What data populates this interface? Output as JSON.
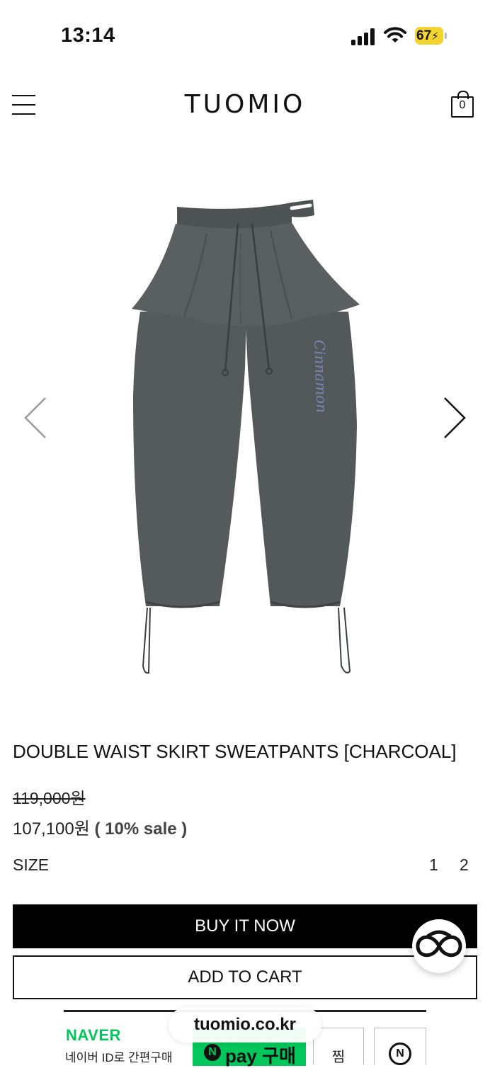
{
  "status_bar": {
    "time": "13:14",
    "battery": "67"
  },
  "header": {
    "logo": "TUOMIO",
    "cart_count": "0"
  },
  "product": {
    "title": "DOUBLE WAIST SKIRT SWEATPANTS [CHARCOAL]",
    "original_price": "119,000원",
    "sale_price": "107,100원",
    "sale_percent": "( 10% sale )",
    "size_label": "SIZE",
    "sizes": [
      "1",
      "2"
    ],
    "embroidery_text": "Cinnamon"
  },
  "actions": {
    "buy_now": "BUY IT NOW",
    "add_to_cart": "ADD TO CART"
  },
  "naver": {
    "brand": "NAVER",
    "subtitle": "네이버 ID로 간편구매",
    "pay_mark": "N",
    "pay_label": "pay 구매",
    "wish_label": "찜",
    "talk_mark": "N"
  },
  "browser": {
    "url": "tuomio.co.kr"
  },
  "colors": {
    "accent_black": "#000000",
    "naver_green": "#03c75a",
    "battery_yellow": "#f4d530",
    "product_charcoal": "#555a5b"
  }
}
